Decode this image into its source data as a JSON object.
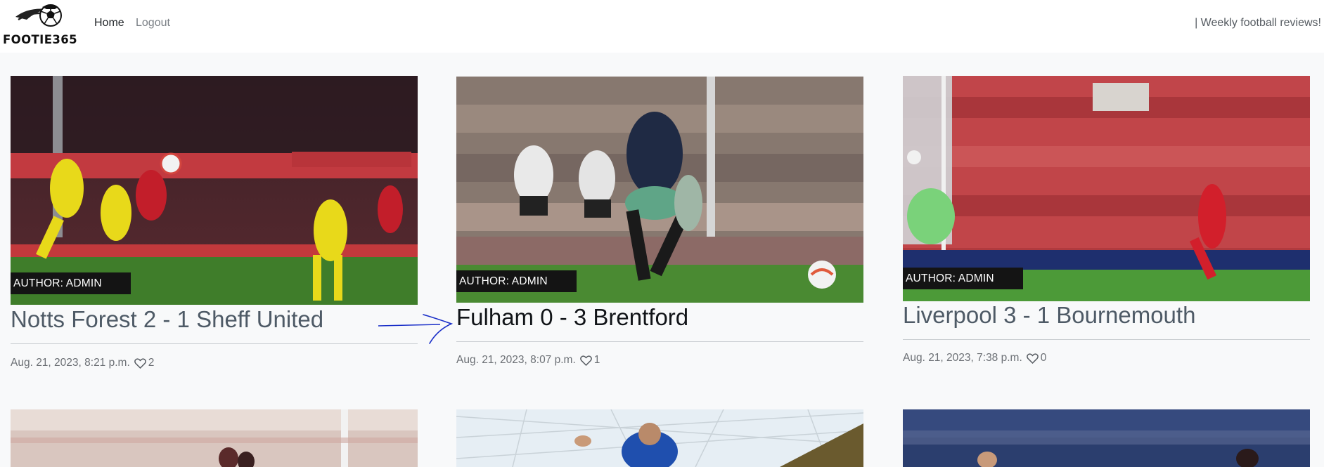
{
  "brand": {
    "text": "FOOTIE365",
    "logo_icon": "football-logo-icon"
  },
  "nav": {
    "home": "Home",
    "logout": "Logout"
  },
  "tagline": "| Weekly football reviews!",
  "posts": [
    {
      "author": "AUTHOR: ADMIN",
      "title": "Notts Forest 2 - 1 Sheff United",
      "date": "Aug. 21, 2023, 8:21 p.m.",
      "likes": "2"
    },
    {
      "author": "AUTHOR: ADMIN",
      "title": "Fulham 0 - 3 Brentford",
      "date": "Aug. 21, 2023, 8:07 p.m.",
      "likes": "1"
    },
    {
      "author": "AUTHOR: ADMIN",
      "title": "Liverpool 3 - 1 Bournemouth",
      "date": "Aug. 21, 2023, 7:38 p.m.",
      "likes": "0"
    }
  ],
  "annotation": {
    "arrow_color": "#1a2fc8"
  },
  "colors": {
    "title_link": "#4e5a66",
    "title_hover": "#111418",
    "badge_bg": "#141414"
  }
}
